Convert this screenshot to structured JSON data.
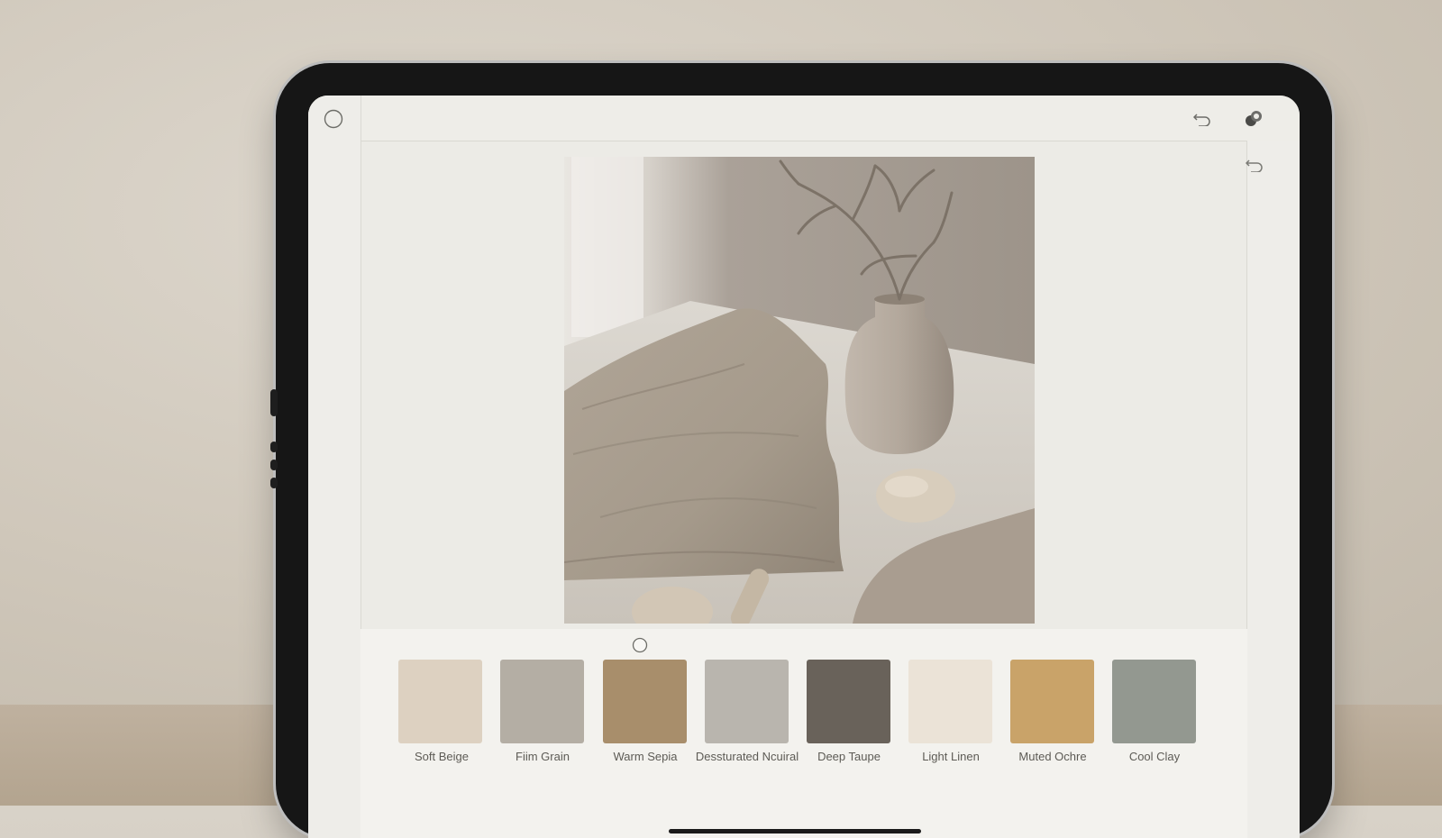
{
  "palette": {
    "swatches": [
      {
        "label": "Soft Beige",
        "color": "#ddd1c1"
      },
      {
        "label": "Fiim Grain",
        "color": "#b4aea4"
      },
      {
        "label": "Warm Sepia",
        "color": "#a88e6b"
      },
      {
        "label": "Dessturated Ncuiral",
        "color": "#b9b5ae"
      },
      {
        "label": "Deep Taupe",
        "color": "#69625a"
      },
      {
        "label": "Light Linen",
        "color": "#ebe3d7"
      },
      {
        "label": "Muted Ochre",
        "color": "#c9a369"
      },
      {
        "label": "Cool Clay",
        "color": "#939890"
      }
    ]
  },
  "icons": {
    "top_left": "circle-icon",
    "top_undo": "undo-icon",
    "top_right": "color-blend-icon",
    "rail_undo": "undo-icon",
    "palette_handle": "circle-handle-icon"
  },
  "colors": {
    "screen_bg": "#ecebe6",
    "bezel": "#161616"
  }
}
